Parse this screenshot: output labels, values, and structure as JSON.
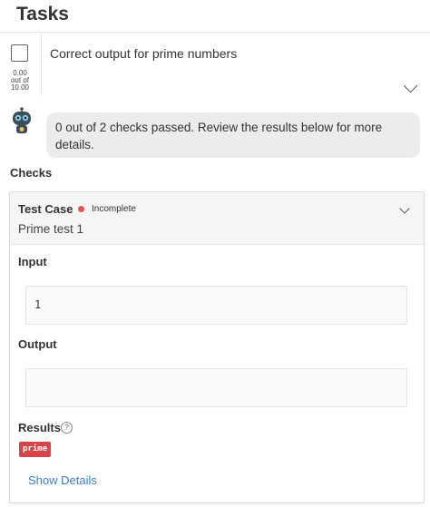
{
  "header": {
    "title": "Tasks"
  },
  "task": {
    "title": "Correct output for prime numbers",
    "score_line1": "0.00",
    "score_line2": "out of",
    "score_line3": "10.00"
  },
  "assistant": {
    "message": "0 out of 2 checks passed. Review the results below for more details."
  },
  "checks": {
    "label": "Checks",
    "test_case": {
      "label": "Test Case",
      "status": "Incomplete",
      "status_color": "#e05555",
      "name": "Prime test 1",
      "input_label": "Input",
      "input_value": "1",
      "output_label": "Output",
      "output_value": "",
      "results_label": "Results",
      "results_badge": "prime",
      "show_details": "Show Details"
    }
  },
  "icons": {
    "checkbox": "checkbox-icon",
    "chevron": "chevron-down-icon",
    "bot": "robot-icon",
    "help": "help-icon"
  },
  "colors": {
    "accent_link": "#3b7fc4",
    "badge_red": "#d9434a",
    "bubble_bg": "#ececec"
  }
}
